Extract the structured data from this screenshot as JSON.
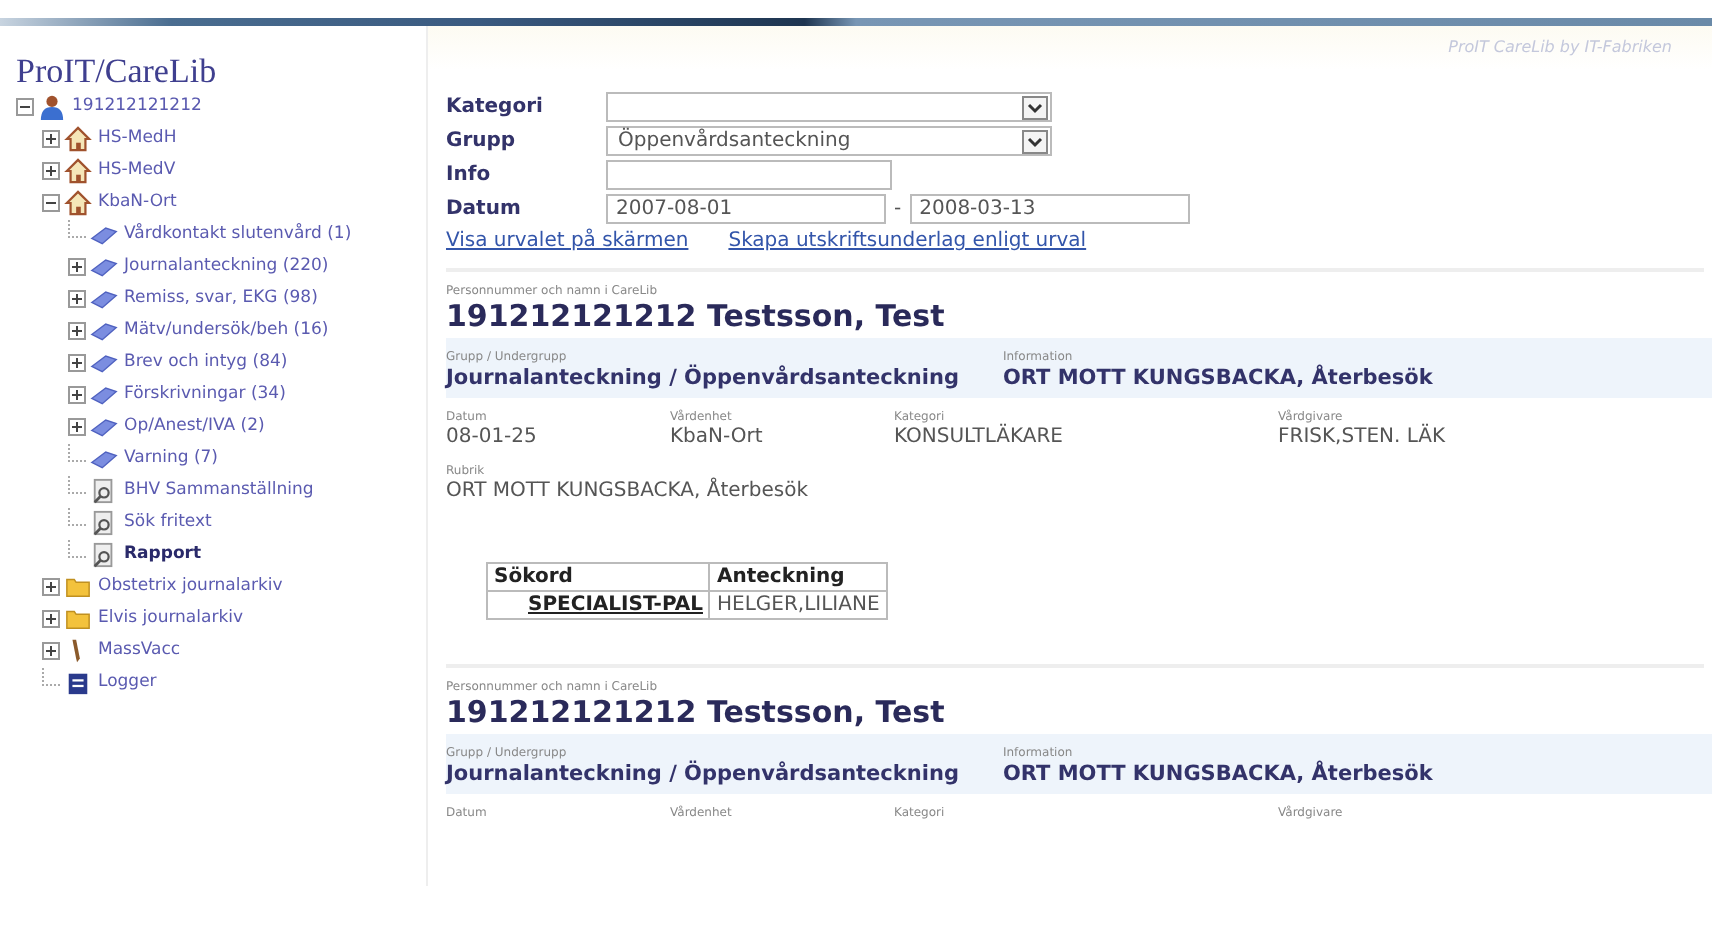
{
  "header": {
    "credit": "ProIT CareLib by IT-Fabriken"
  },
  "sidebar": {
    "title": "ProIT/CareLib",
    "tree": [
      {
        "label": "191212121212",
        "kind": "person",
        "expanded": true,
        "selected": false,
        "children": [
          {
            "label": "HS-MedH",
            "kind": "house",
            "expanded": false,
            "selected": false
          },
          {
            "label": "HS-MedV",
            "kind": "house",
            "expanded": false,
            "selected": false
          },
          {
            "label": "KbaN-Ort",
            "kind": "house",
            "expanded": true,
            "selected": false,
            "children": [
              {
                "label": "Vårdkontakt slutenvård (1)",
                "kind": "category",
                "selected": false
              },
              {
                "label": "Journalanteckning (220)",
                "kind": "category",
                "expanded": false,
                "selected": false
              },
              {
                "label": "Remiss, svar, EKG (98)",
                "kind": "category",
                "expanded": false,
                "selected": false
              },
              {
                "label": "Mätv/undersök/beh (16)",
                "kind": "category",
                "expanded": false,
                "selected": false
              },
              {
                "label": "Brev och intyg (84)",
                "kind": "category",
                "expanded": false,
                "selected": false
              },
              {
                "label": "Förskrivningar (34)",
                "kind": "category",
                "expanded": false,
                "selected": false
              },
              {
                "label": "Op/Anest/IVA (2)",
                "kind": "category",
                "expanded": false,
                "selected": false
              },
              {
                "label": "Varning (7)",
                "kind": "category",
                "selected": false
              },
              {
                "label": "BHV Sammanställning",
                "kind": "report",
                "selected": false
              },
              {
                "label": "Sök fritext",
                "kind": "report",
                "selected": false
              },
              {
                "label": "Rapport",
                "kind": "report",
                "selected": true
              }
            ]
          },
          {
            "label": "Obstetrix journalarkiv",
            "kind": "archive",
            "expanded": false,
            "selected": false
          },
          {
            "label": "Elvis journalarkiv",
            "kind": "archive",
            "expanded": false,
            "selected": false
          },
          {
            "label": "MassVacc",
            "kind": "vaccine",
            "expanded": false,
            "selected": false
          },
          {
            "label": "Logger",
            "kind": "log",
            "selected": false
          }
        ]
      }
    ]
  },
  "filter": {
    "fields": [
      {
        "label": "Kategori",
        "kind": "select"
      },
      {
        "label": "Grupp",
        "kind": "select",
        "value": "Öppenvårdsanteckning"
      },
      {
        "label": "Info",
        "kind": "text"
      },
      {
        "label": "Datum",
        "kind": "range",
        "value": "2007-08-01",
        "value_to": "2008-03-13",
        "separator": "-"
      }
    ],
    "links": [
      "Visa urvalet på skärmen",
      "Skapa utskriftsunderlag enligt urval"
    ]
  },
  "records": [
    {
      "person_label": "Personnummer och namn i CareLib",
      "person": "191212121212 Testsson, Test",
      "band": [
        {
          "label": "Grupp / Undergrupp",
          "value": "Journalanteckning / Öppenvårdsanteckning"
        },
        {
          "label": "Information",
          "value": "ORT MOTT KUNGSBACKA, Återbesök"
        }
      ],
      "details": [
        {
          "label": "Datum",
          "value": "08-01-25"
        },
        {
          "label": "Vårdenhet",
          "value": "KbaN-Ort"
        },
        {
          "label": "Kategori",
          "value": "KONSULTLÄKARE"
        },
        {
          "label": "Vårdgivare",
          "value": "FRISK,STEN. LÄK"
        }
      ],
      "rubric": {
        "label": "Rubrik",
        "value": "ORT MOTT KUNGSBACKA, Återbesök"
      },
      "table": {
        "columns": [
          "Sökord",
          "Anteckning"
        ],
        "rows": [
          [
            "SPECIALIST-PAL",
            "HELGER,LILIANE"
          ]
        ]
      }
    },
    {
      "person_label": "Personnummer och namn i CareLib",
      "person": "191212121212 Testsson, Test",
      "band": [
        {
          "label": "Grupp / Undergrupp",
          "value": "Journalanteckning / Öppenvårdsanteckning"
        },
        {
          "label": "Information",
          "value": "ORT MOTT KUNGSBACKA, Återbesök"
        }
      ],
      "details": [
        {
          "label": "Datum"
        },
        {
          "label": "Vårdenhet"
        },
        {
          "label": "Kategori"
        },
        {
          "label": "Vårdgivare"
        }
      ]
    }
  ]
}
